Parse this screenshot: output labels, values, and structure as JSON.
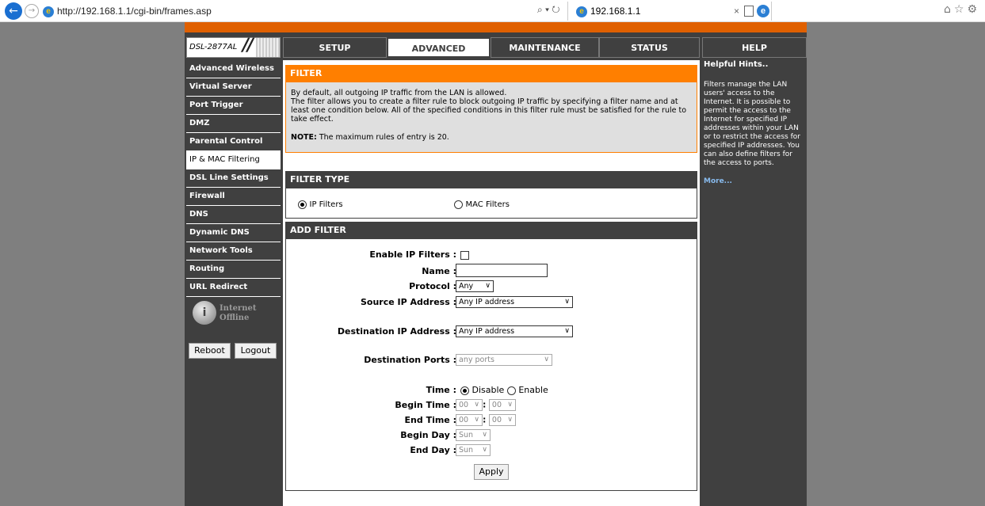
{
  "browser": {
    "url": "http://192.168.1.1/cgi-bin/frames.asp",
    "search_control": "⌕ ▾ ↻",
    "tab_title": "192.168.1.1",
    "tab_close": "×"
  },
  "header": {
    "model": "DSL-2877AL",
    "nav": [
      "SETUP",
      "ADVANCED",
      "MAINTENANCE",
      "STATUS",
      "HELP"
    ],
    "active_nav": "ADVANCED"
  },
  "sidebar": {
    "items": [
      {
        "label": "Advanced Wireless"
      },
      {
        "label": "Virtual Server"
      },
      {
        "label": "Port Trigger"
      },
      {
        "label": "DMZ"
      },
      {
        "label": "Parental Control"
      },
      {
        "label": "IP & MAC Filtering"
      },
      {
        "label": "DSL Line Settings"
      },
      {
        "label": "Firewall"
      },
      {
        "label": "DNS"
      },
      {
        "label": "Dynamic DNS"
      },
      {
        "label": "Network Tools"
      },
      {
        "label": "Routing"
      },
      {
        "label": "URL Redirect"
      }
    ],
    "active": "IP & MAC Filtering",
    "status_line1": "Internet",
    "status_line2": "Offline",
    "reboot_label": "Reboot",
    "logout_label": "Logout"
  },
  "filter": {
    "title": "FILTER",
    "text1": "By default, all outgoing IP traffic from the LAN is allowed.",
    "text2": "The filter allows you to create a filter rule to block outgoing IP traffic by specifying a filter name and at least one condition below. All of the specified conditions in this filter rule must be satisfied for the rule to take effect.",
    "note_label": "NOTE:",
    "note_text": " The maximum rules of entry is 20."
  },
  "filter_type": {
    "title": "FILTER TYPE",
    "ip_label": "IP Filters",
    "mac_label": "MAC Filters",
    "selected": "ip"
  },
  "add_filter": {
    "title": "ADD FILTER",
    "enable_label": "Enable IP Filters :",
    "enable_checked": false,
    "name_label": "Name :",
    "name_value": "",
    "protocol_label": "Protocol :",
    "protocol_value": "Any",
    "source_label": "Source IP Address :",
    "source_value": "Any IP address",
    "dest_label": "Destination IP Address :",
    "dest_value": "Any IP address",
    "ports_label": "Destination Ports :",
    "ports_value": "any ports",
    "time_label": "Time :",
    "time_disable": "Disable",
    "time_enable": "Enable",
    "time_selected": "Disable",
    "begin_time_label": "Begin Time :",
    "end_time_label": "End Time :",
    "hour_value": "00",
    "minute_value": "00",
    "time_sep": ":",
    "begin_day_label": "Begin Day :",
    "end_day_label": "End Day :",
    "day_value": "Sun",
    "apply_label": "Apply"
  },
  "hints": {
    "title": "Helpful Hints..",
    "text": "Filters manage the LAN users' access to the Internet. It is possible to permit the access to the Internet for specified IP addresses within your LAN or to restrict the access for specified IP addresses. You can also define filters for the access to ports.",
    "more": "More..."
  }
}
